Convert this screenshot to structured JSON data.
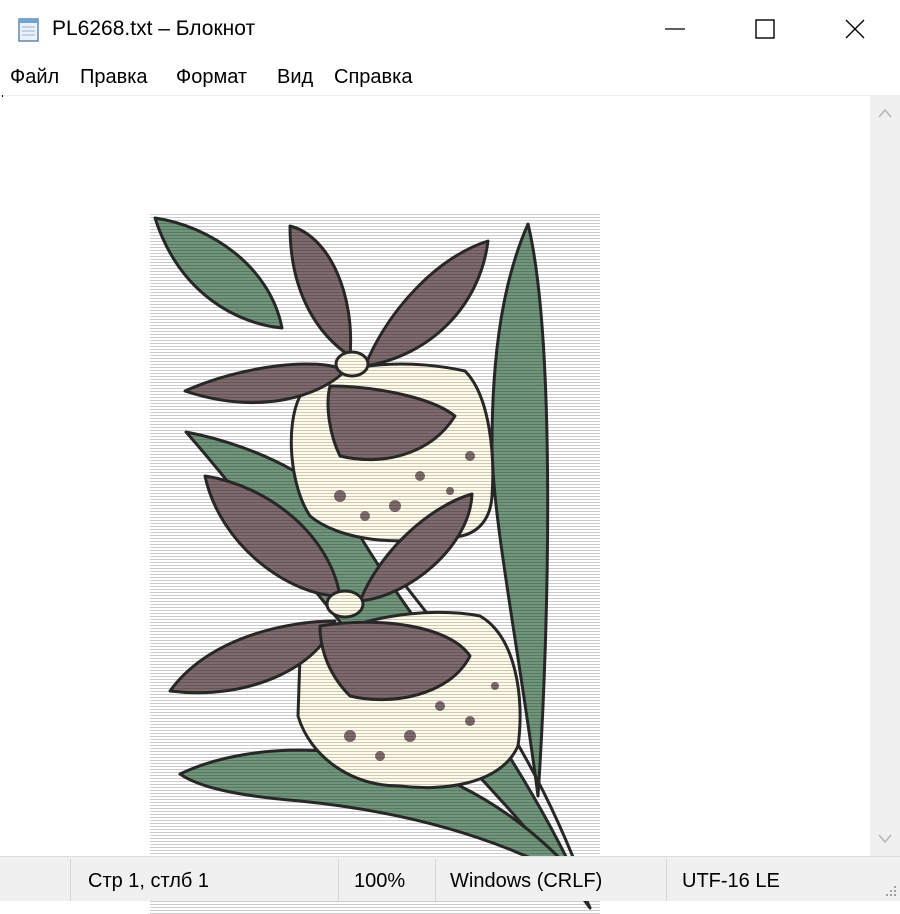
{
  "window": {
    "title": "PL6268.txt – Блокнот",
    "icon": "notepad-icon"
  },
  "menu": {
    "file": "Файл",
    "edit": "Правка",
    "format": "Формат",
    "view": "Вид",
    "help": "Справка"
  },
  "editor": {
    "content_kind": "ascii-art-orchid",
    "colors": {
      "petal": "#7e6a6c",
      "leaf": "#6f957a",
      "lip": "#fffbe8",
      "outline": "#2a2a2a"
    }
  },
  "status": {
    "position": "Стр 1, стлб 1",
    "zoom": "100%",
    "line_ending": "Windows (CRLF)",
    "encoding": "UTF-16 LE"
  }
}
